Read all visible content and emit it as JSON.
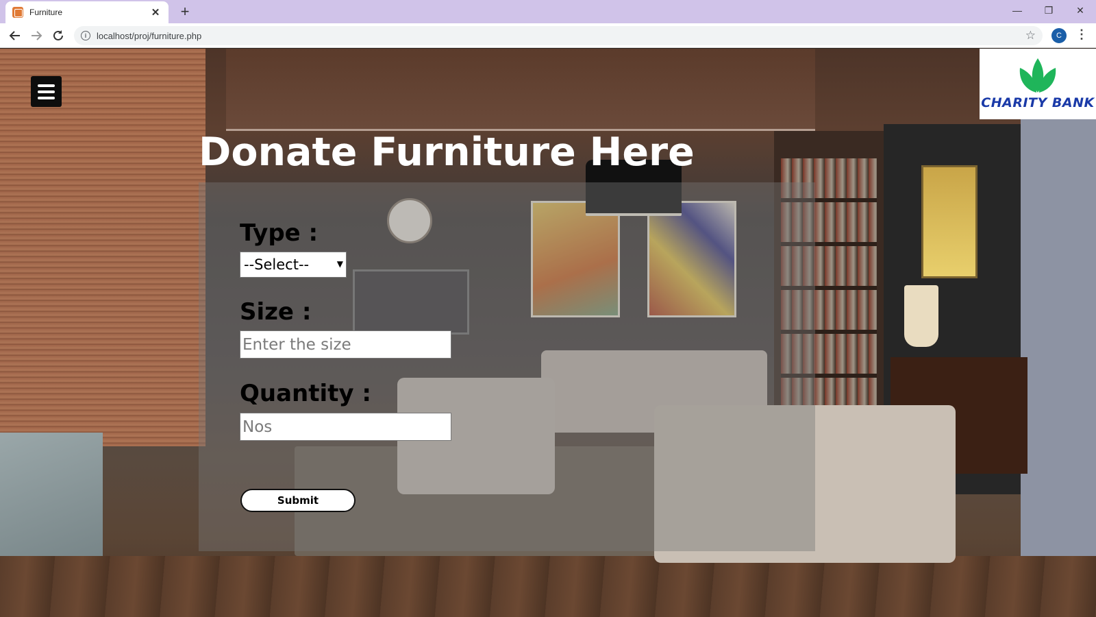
{
  "browser": {
    "tab_title": "Furniture",
    "tab_close": "✕",
    "new_tab": "+",
    "url": "localhost/proj/furniture.php",
    "profile_initial": "C",
    "window_controls": {
      "minimize": "—",
      "restore": "❐",
      "close": "✕"
    }
  },
  "page": {
    "logo_text": "CHARITY BANK",
    "title": "Donate Furniture Here",
    "form": {
      "type_label": "Type :",
      "type_selected": "--Select--",
      "size_label": "Size :",
      "size_placeholder": "Enter the size",
      "quantity_label": "Quantity :",
      "quantity_placeholder": "Nos",
      "submit_label": "Submit"
    }
  },
  "colors": {
    "titlebar": "#d0c3e9",
    "logo_blue": "#1a3aa8",
    "logo_green": "#1fb55a",
    "profile": "#1a5ea8"
  }
}
